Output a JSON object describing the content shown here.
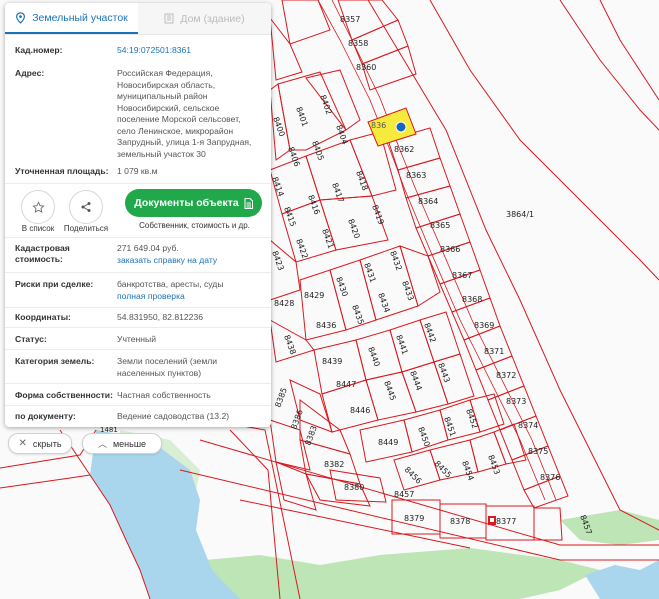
{
  "tabs": {
    "parcel": "Земельный участок",
    "building": "Дом (здание)"
  },
  "parcel": {
    "cadastral_label": "Кад.номер:",
    "cadastral_number": "54:19:072501:8361",
    "address_label": "Адрес:",
    "address_lines": [
      "Российская Федерация,",
      "Новосибирская область,",
      "муниципальный район",
      "Новосибирский, сельское",
      "поселение Морской сельсовет,",
      "село Ленинское, микрорайон",
      "Запрудный, улица 1-я Запрудная,",
      "земельный участок 30"
    ],
    "area_label": "Уточненная площадь:",
    "area_value": "1 079 кв.м"
  },
  "actions": {
    "add_to_list": "В список",
    "share": "Поделиться",
    "documents_button": "Документы объекта",
    "documents_subtitle": "Собственник, стоимость и др."
  },
  "details": {
    "value_label_1": "Кадастровая",
    "value_label_2": "стоимость:",
    "value_amount": "271 649.04 руб.",
    "value_link": "заказать справку на дату",
    "risks_label": "Риски при сделке:",
    "risks_value": "банкротства, аресты, суды",
    "risks_link": "полная проверка",
    "coords_label": "Координаты:",
    "coords_value": "54.831950, 82.812236",
    "status_label": "Статус:",
    "status_value": "Учтенный",
    "category_label": "Категория земель:",
    "category_lines": [
      "Земли поселений (земли",
      "населенных пунктов)"
    ],
    "ownership_label": "Форма собственности:",
    "ownership_value": "Частная собственность",
    "document_label": "по документу:",
    "document_value": "Ведение садоводства (13.2)"
  },
  "controls": {
    "hide": "скрыть",
    "less": "меньше"
  },
  "map": {
    "colors": {
      "boundary": "#d8191f",
      "selected_fill": "#f6ea3c",
      "water": "#a9d6ec",
      "green": "#bde5b5",
      "marker": "#1565c0"
    },
    "partial_selected_label": "836",
    "big_parcel_label": "3864/1",
    "corner_label": "1481",
    "plot_labels": [
      "8357",
      "8358",
      "8360",
      "8362",
      "8363",
      "8364",
      "8365",
      "8366",
      "8367",
      "8368",
      "8369",
      "8371",
      "8372",
      "8373",
      "8374",
      "8375",
      "8376",
      "8377",
      "8378",
      "8379",
      "8380",
      "8382",
      "8383",
      "8385",
      "8386",
      "8401",
      "8402",
      "8404",
      "8405",
      "8406",
      "8400",
      "8414",
      "8415",
      "8416",
      "8417",
      "8418",
      "8419",
      "8420",
      "8421",
      "8422",
      "8423",
      "8428",
      "8429",
      "8430",
      "8431",
      "8432",
      "8433",
      "8434",
      "8435",
      "8436",
      "8438",
      "8439",
      "8440",
      "8441",
      "8442",
      "8443",
      "8444",
      "8445",
      "8446",
      "8447",
      "8449",
      "8450",
      "8451",
      "8452",
      "8453",
      "8454",
      "8455",
      "8456",
      "8457",
      "8457b"
    ]
  }
}
